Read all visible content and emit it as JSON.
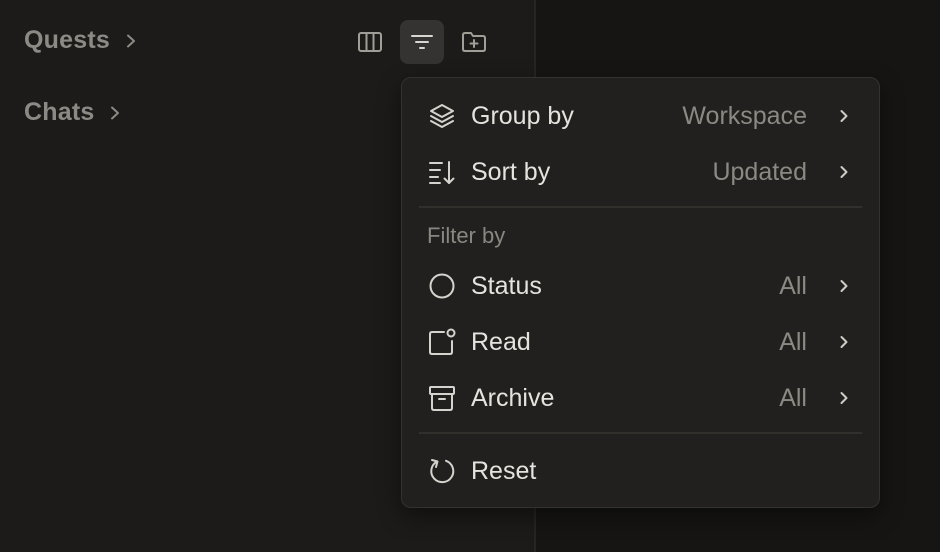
{
  "sidebar": {
    "sections": [
      {
        "label": "Quests"
      },
      {
        "label": "Chats"
      }
    ]
  },
  "toolbar": {
    "buttons": [
      {
        "icon": "columns-icon",
        "active": false
      },
      {
        "icon": "filter-icon",
        "active": true
      },
      {
        "icon": "new-folder-icon",
        "active": false
      }
    ]
  },
  "menu": {
    "group_by": {
      "label": "Group by",
      "value": "Workspace",
      "icon": "layers-icon"
    },
    "sort_by": {
      "label": "Sort by",
      "value": "Updated",
      "icon": "sort-icon"
    },
    "filter_section_label": "Filter by",
    "status": {
      "label": "Status",
      "value": "All",
      "icon": "circle-icon"
    },
    "read": {
      "label": "Read",
      "value": "All",
      "icon": "unread-dot-icon"
    },
    "archive": {
      "label": "Archive",
      "value": "All",
      "icon": "archive-icon"
    },
    "reset": {
      "label": "Reset",
      "icon": "reset-icon"
    }
  },
  "colors": {
    "background": "#1a1918",
    "menu_background": "#21201e",
    "text_primary": "#e6e3de",
    "text_secondary": "#8c8984",
    "active_button": "#353331"
  }
}
